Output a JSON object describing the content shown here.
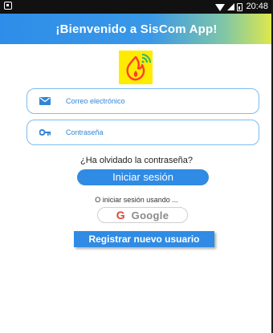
{
  "status_bar": {
    "time": "20:48",
    "icons": [
      "notification-icon",
      "wifi-icon",
      "cell-signal-icon",
      "battery-icon"
    ]
  },
  "app_bar": {
    "title": "¡Bienvenido a SisCom App!",
    "gradient_colors": [
      "#2e8de8",
      "#e0e94a"
    ]
  },
  "logo": {
    "icon": "flame-wifi-logo",
    "background": "#ffeb00",
    "accent": "#ff3b30"
  },
  "form": {
    "email": {
      "icon": "email-icon",
      "label": "Correo electrónico"
    },
    "password": {
      "icon": "key-icon",
      "label": "Contraseña"
    }
  },
  "links": {
    "forgot_password": "¿Ha olvidado la contraseña?"
  },
  "buttons": {
    "login": "Iniciar sesión",
    "or_sign_in_with": "O iniciar sesión usando ...",
    "google_letter": "G",
    "google": "Google",
    "register": "Registrar nuevo usuario"
  },
  "colors": {
    "primary": "#2f8be4",
    "field_border": "#7bbcf0",
    "label": "#2f86d6"
  }
}
